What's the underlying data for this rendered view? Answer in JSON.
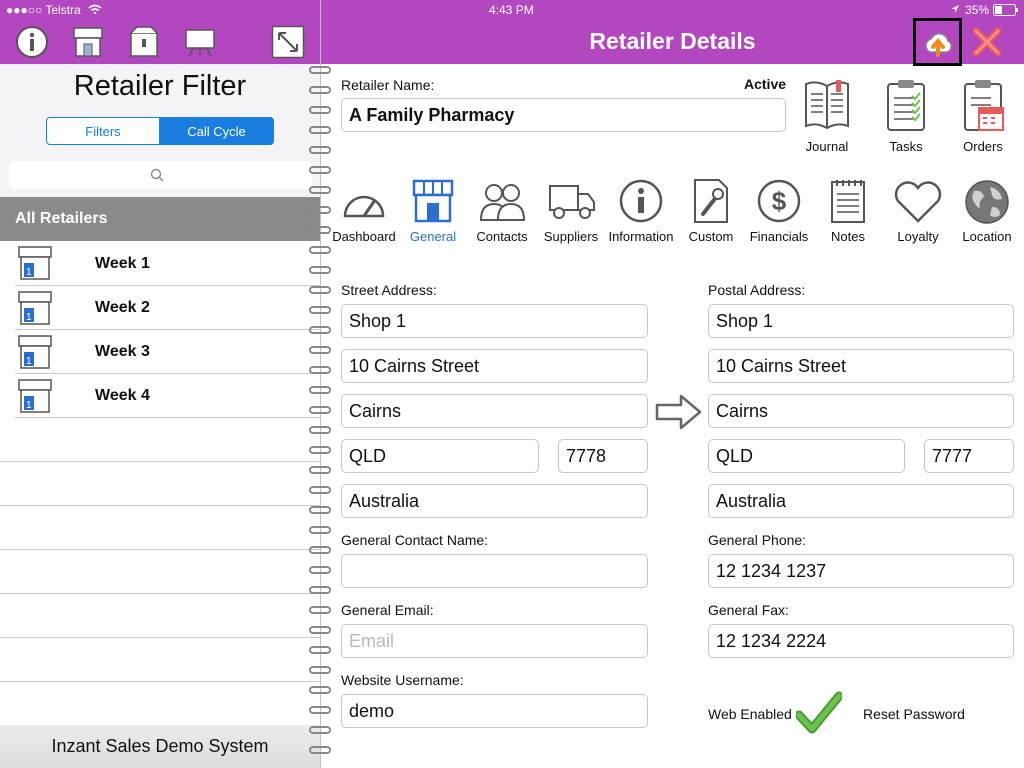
{
  "status_bar": {
    "carrier": "●●●○○ Telstra",
    "time": "4:43 PM",
    "battery": "35%"
  },
  "colors": {
    "header": "#b347c0",
    "accent_blue": "#1a7ee0",
    "selected_nav": "#2a6fd0",
    "check_green": "#6cc24a",
    "close_red": "#e85a5a"
  },
  "left_toolbar": {
    "icons": [
      "info-icon",
      "store-icon",
      "box-icon",
      "presentation-icon",
      "resize-icon"
    ]
  },
  "left_panel": {
    "title": "Retailer Filter",
    "segments": [
      "Filters",
      "Call Cycle"
    ],
    "selected_segment": "Call Cycle",
    "search_placeholder": "",
    "all_retailers": "All Retailers",
    "weeks": [
      "Week 1",
      "Week 2",
      "Week 3",
      "Week 4"
    ],
    "footer": "Inzant Sales Demo System"
  },
  "header": {
    "title": "Retailer Details"
  },
  "retailer": {
    "name_label": "Retailer Name:",
    "name": "A Family Pharmacy",
    "status": "Active"
  },
  "tools": [
    "Journal",
    "Tasks",
    "Orders"
  ],
  "nav": {
    "items": [
      "Dashboard",
      "General",
      "Contacts",
      "Suppliers",
      "Information",
      "Custom",
      "Financials",
      "Notes",
      "Loyalty",
      "Location"
    ],
    "selected": "General"
  },
  "street": {
    "label": "Street Address:",
    "line1": "Shop 1",
    "line2": "10 Cairns Street",
    "city": "Cairns",
    "state": "QLD",
    "postcode": "7778",
    "country": "Australia"
  },
  "postal": {
    "label": "Postal Address:",
    "line1": "Shop 1",
    "line2": "10 Cairns Street",
    "city": "Cairns",
    "state": "QLD",
    "postcode": "7777",
    "country": "Australia"
  },
  "contact": {
    "name_label": "General Contact Name:",
    "name_value": "",
    "phone_label": "General Phone:",
    "phone": "12 1234 1237",
    "email_label": "General Email:",
    "email_placeholder": "Email",
    "fax_label": "General Fax:",
    "fax": "12 1234 2224",
    "username_label": "Website Username:",
    "username": "demo",
    "web_enabled": "Web Enabled",
    "reset_password": "Reset Password"
  }
}
